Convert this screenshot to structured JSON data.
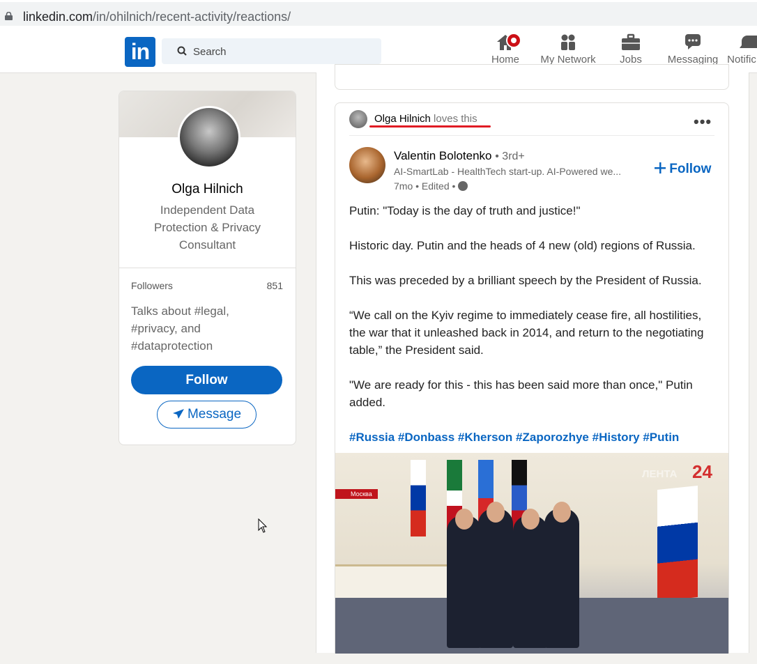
{
  "browser": {
    "url_domain": "linkedin.com",
    "url_path": "/in/ohilnich/recent-activity/reactions/"
  },
  "nav": {
    "logo": "in",
    "search_placeholder": "Search",
    "items": [
      {
        "label": "Home",
        "icon": "home-icon"
      },
      {
        "label": "My Network",
        "icon": "network-icon"
      },
      {
        "label": "Jobs",
        "icon": "briefcase-icon"
      },
      {
        "label": "Messaging",
        "icon": "chat-icon"
      },
      {
        "label": "Notific",
        "icon": "bell-icon"
      }
    ]
  },
  "profile": {
    "name": "Olga Hilnich",
    "headline": "Independent Data Protection & Privacy Consultant",
    "followers_label": "Followers",
    "followers_count": "851",
    "talks_about": "Talks about #legal, #privacy, and #dataprotection",
    "follow_label": "Follow",
    "message_label": "Message"
  },
  "post": {
    "context_name": "Olga Hilnich",
    "context_verb": "loves this",
    "author_name": "Valentin Bolotenko",
    "author_degree": "• 3rd+",
    "author_headline": "AI-SmartLab - HealthTech start-up. AI-Powered we...",
    "post_time": "7mo • Edited •",
    "follow_label": "Follow",
    "paragraphs": [
      "Putin: \"Today is the day of truth and justice!\"",
      "Historic day. Putin and the heads of 4 new (old) regions of Russia.",
      "This was preceded by a brilliant speech by the President of Russia.",
      "“We call on the Kyiv regime to immediately cease fire, all hostilities, the war that it unleashed back in 2014, and return to the negotiating table,” the President said.",
      "\"We are ready for this - this has been said more than once,\" Putin added."
    ],
    "hashtags": "#Russia #Donbass #Kherson #Zaporozhye #History #Putin",
    "image_caption_tag": "Москва",
    "image_channel": "24",
    "image_channel_text": "ЛЕНТА"
  }
}
